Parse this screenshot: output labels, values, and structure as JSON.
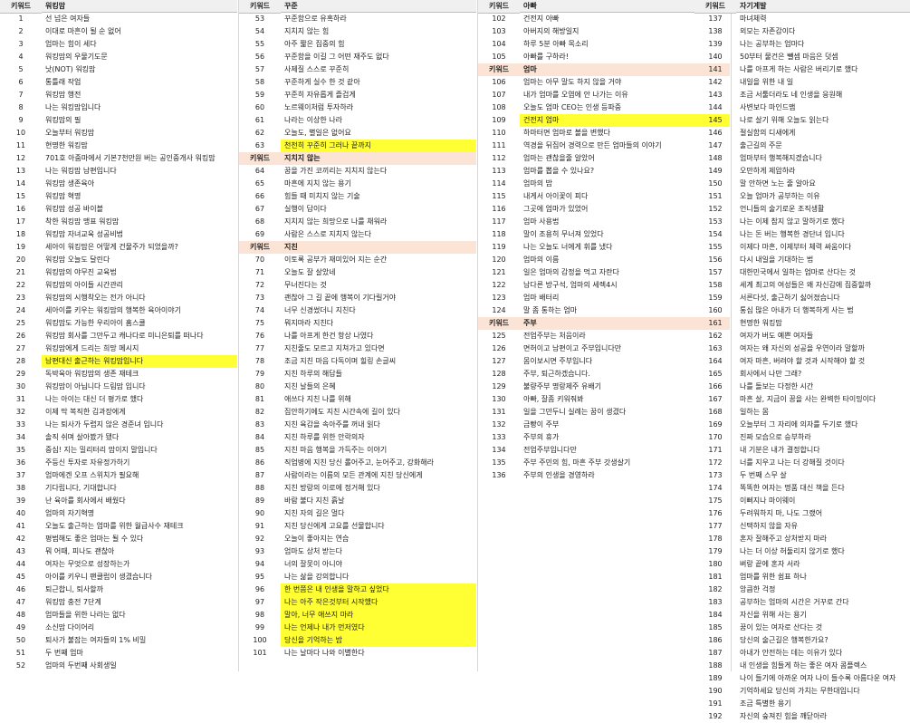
{
  "columns": [
    {
      "header": {
        "key": "키워드",
        "title": "워킹맘"
      },
      "rows": [
        {
          "n": "1",
          "t": "선 넘은 여자들"
        },
        {
          "n": "2",
          "t": "이대로 마흔이 될 순 없어"
        },
        {
          "n": "3",
          "t": "엄마는 힘이 세다"
        },
        {
          "n": "4",
          "t": "워킹맘의 우물기도문"
        },
        {
          "n": "5",
          "t": "낫(NOT) 워킹맘"
        },
        {
          "n": "6",
          "t": "통틀래 작업"
        },
        {
          "n": "7",
          "t": "워킹맘 행전"
        },
        {
          "n": "8",
          "t": "나는 워킹맘입니다"
        },
        {
          "n": "9",
          "t": "워킹맘의 필"
        },
        {
          "n": "10",
          "t": "오늘부터 워킹맘"
        },
        {
          "n": "11",
          "t": "현명한 워킹맘"
        },
        {
          "n": "12",
          "t": "701호 아줌마에서 기본7천만원 버는 공인중개사 워킹맘"
        },
        {
          "n": "13",
          "t": "나는 워킹맘 남편입니다"
        },
        {
          "n": "14",
          "t": "워킹맘 생존육아"
        },
        {
          "n": "15",
          "t": "워킹맘 혁명"
        },
        {
          "n": "16",
          "t": "워킹맘 성공 바이블"
        },
        {
          "n": "17",
          "t": "착한 워킹맘 맹표 워킹맘"
        },
        {
          "n": "18",
          "t": "워킹맘 자녀교육 성공비법"
        },
        {
          "n": "19",
          "t": "세아이 워킹맘은 어떻게 건물주가 되었을까?"
        },
        {
          "n": "20",
          "t": "워킹맘 오늘도 달린다"
        },
        {
          "n": "21",
          "t": "워킹맘의 야무진 교육법"
        },
        {
          "n": "22",
          "t": "워킹맘의 아이들 시간관리"
        },
        {
          "n": "23",
          "t": "워킹맘의 시행착오는 전가 아니다"
        },
        {
          "n": "24",
          "t": "세아이를 키우는 워킹맘의 행복한 육아이야기"
        },
        {
          "n": "25",
          "t": "워킹맘도 가능한 우리아이 홈스쿨"
        },
        {
          "n": "26",
          "t": "워킹맘 회사를 그만두고 캐나다로 미니은퇴를 떠나다"
        },
        {
          "n": "27",
          "t": "워킹맘에게 드리는 희망 메시지"
        },
        {
          "n": "28",
          "t": "남편대신 출근하는 워킹맘입니다",
          "hl": true
        },
        {
          "n": "29",
          "t": "독박육아 워킹맘의 생존 재테크"
        },
        {
          "n": "30",
          "t": "워킹맘이 아닙니다 드림맘 입니다"
        },
        {
          "n": "31",
          "t": "나는 아이는 대신 더 평가로 했다"
        },
        {
          "n": "32",
          "t": "이제 막 복직한 김과장에게"
        },
        {
          "n": "33",
          "t": "나는 퇴사가 두렵지 않은 경준녀 입니다"
        },
        {
          "n": "34",
          "t": "솔직 쉬며 살아봤가 됐다"
        },
        {
          "n": "35",
          "t": "중심! 지는 밀리터리 맘이지 말입니다"
        },
        {
          "n": "36",
          "t": "주등신 투자로 자유정가하기"
        },
        {
          "n": "37",
          "t": "엄마에겐 오프 스위치가 필요해"
        },
        {
          "n": "38",
          "t": "기다립니다, 기대합니다"
        },
        {
          "n": "39",
          "t": "난 육아를 회사에서 배웠다"
        },
        {
          "n": "40",
          "t": "엄마의 자기혁명"
        },
        {
          "n": "41",
          "t": "오늘도 출근하는 엄마를 위한 월급사수 재테크"
        },
        {
          "n": "42",
          "t": "평범해도 좋은 엄마는 될 수 있다"
        },
        {
          "n": "43",
          "t": "뭐 어때, 피나도 괜찮아"
        },
        {
          "n": "44",
          "t": "여자는 무엇으로 성장하는가"
        },
        {
          "n": "45",
          "t": "아이를 키우니 팬클럽이 생겼습니다"
        },
        {
          "n": "46",
          "t": "퇴근합니, 퇴사할까"
        },
        {
          "n": "47",
          "t": "워킹맘 충전 7단계"
        },
        {
          "n": "48",
          "t": "엄마들을 위한 나라는 없다"
        },
        {
          "n": "49",
          "t": "소신맘 다이어리"
        },
        {
          "n": "50",
          "t": "퇴사가 불잡는 여자들의 1% 비밀"
        },
        {
          "n": "51",
          "t": "두 번째 엄마"
        },
        {
          "n": "52",
          "t": "엄마의 두번째 사회생일"
        }
      ]
    },
    {
      "header": {
        "key": "키워드",
        "title": "꾸준"
      },
      "rows": [
        {
          "n": "53",
          "t": "꾸준함으로 유혹하라"
        },
        {
          "n": "54",
          "t": "지치지 않는 힘"
        },
        {
          "n": "55",
          "t": "아주 짧은 집중의 힘"
        },
        {
          "n": "56",
          "t": "꾸준함을 이길 그 어떤 재주도 없다"
        },
        {
          "n": "57",
          "t": "사제질 스스로 꾸준히"
        },
        {
          "n": "58",
          "t": "꾸준하게 실수 한 것 같아"
        },
        {
          "n": "59",
          "t": "꾸준히 자유롭게 즐겁게"
        },
        {
          "n": "60",
          "t": "노르웨이처럼 투자하라"
        },
        {
          "n": "61",
          "t": "나라는 이상한 나라"
        },
        {
          "n": "62",
          "t": "오늘도, 별일은 없어요"
        },
        {
          "n": "63",
          "t": "천천히 꾸준히 그러나 끝까지",
          "hl": true
        },
        {
          "sect": true,
          "key": "키워드",
          "title": "지치지 않는"
        },
        {
          "n": "64",
          "t": "꿈을 가진 코끼리는 지치지 않는다"
        },
        {
          "n": "65",
          "t": "마흔에 지치 않는 용기"
        },
        {
          "n": "66",
          "t": "힘들 때 미치지 않는 기술"
        },
        {
          "n": "67",
          "t": "실행이 답이다"
        },
        {
          "n": "68",
          "t": "지치지 않는 희망으로 나를 채워라"
        },
        {
          "n": "69",
          "t": "사람은 스스로 지치지 않는다"
        },
        {
          "sect": true,
          "key": "키워드",
          "title": "지친"
        },
        {
          "n": "70",
          "t": "이토록 공부가 재미있어 지는 순간"
        },
        {
          "n": "71",
          "t": "오늘도 잘 살았네"
        },
        {
          "n": "72",
          "t": "무너진다는 것"
        },
        {
          "n": "73",
          "t": "괜찮아 그 길 끝에 행복이 기다릴거야"
        },
        {
          "n": "74",
          "t": "너무 신경썼더니 지친다"
        },
        {
          "n": "75",
          "t": "뭐지마라 지친다"
        },
        {
          "n": "76",
          "t": "나를 아프게 한건 항상 나였다"
        },
        {
          "n": "77",
          "t": "지친줄도 모르고 지쳐가고 있다면"
        },
        {
          "n": "78",
          "t": "조금 지친 마음 다독이며 힐링 손글씨"
        },
        {
          "n": "79",
          "t": "지친 하루의 해답들"
        },
        {
          "n": "80",
          "t": "지친 날들의 은혜"
        },
        {
          "n": "81",
          "t": "애쓰다 지친 나를 위해"
        },
        {
          "n": "82",
          "t": "집안하기에도 지친 시간속에 길이 있다"
        },
        {
          "n": "83",
          "t": "지친 육감을 속아주를 꺼내 읽다"
        },
        {
          "n": "84",
          "t": "지친 하루를 위한 안락의자"
        },
        {
          "n": "85",
          "t": "지친 마음 행복을 가득주는 이야기"
        },
        {
          "n": "86",
          "t": "직업병에 지친 당신 롤어주고, 눈어주고, 강화해라"
        },
        {
          "n": "87",
          "t": "사람이라는 이름의 모든 관계에 지친 당신에게"
        },
        {
          "n": "88",
          "t": "지친 방랑의 이로에 정거해 있다"
        },
        {
          "n": "89",
          "t": "바람 불다 지친 흙날"
        },
        {
          "n": "90",
          "t": "지친 자의 길은 멀다"
        },
        {
          "n": "91",
          "t": "지친 당신에게 고요를 선물합니다"
        },
        {
          "n": "92",
          "t": "오늘이 좋아지는 연습"
        },
        {
          "n": "93",
          "t": "엄마도 상처 받는다"
        },
        {
          "n": "94",
          "t": "너의 잘못이 아니야"
        },
        {
          "n": "95",
          "t": "나는 삶을 강의합니다"
        },
        {
          "n": "96",
          "t": "한 번쯤은 내 인생을 말하고 싶었다",
          "hl": true
        },
        {
          "n": "97",
          "t": "나는 아주 작은것부터 시작했다",
          "hl": true
        },
        {
          "n": "98",
          "t": "말아, 너무 애쓰지 마라",
          "hl": true
        },
        {
          "n": "99",
          "t": "나는 언제나 내가 먼저였다",
          "hl": true
        },
        {
          "n": "100",
          "t": "당신을 기억하는 밤",
          "hl": true
        },
        {
          "n": "101",
          "t": "나는 날마다 나와 이별한다"
        }
      ]
    },
    {
      "header": {
        "key": "키워드",
        "title": "아빠"
      },
      "rows": [
        {
          "n": "102",
          "t": "건전지 아빠"
        },
        {
          "n": "103",
          "t": "아버지의 해방일지"
        },
        {
          "n": "104",
          "t": "하루 5분 아빠 목소리"
        },
        {
          "n": "105",
          "t": "아빠를 구하라!"
        },
        {
          "sect": true,
          "key": "키워드",
          "title": "엄마"
        },
        {
          "n": "106",
          "t": "엄마는 아무 말도 하지 않을 거야"
        },
        {
          "n": "107",
          "t": "내가 엄마를 오염에 안 나가는 이유"
        },
        {
          "n": "108",
          "t": "오늘도 엄마 CEO는 인생 등파중"
        },
        {
          "n": "109",
          "t": "건전지 엄마",
          "hl": true
        },
        {
          "n": "110",
          "t": "하마터면 엄마로 볼을 변했다"
        },
        {
          "n": "111",
          "t": "역경을 뒤집어 경력으로 만든 엄마들의 이야기"
        },
        {
          "n": "112",
          "t": "엄마는 괜찮을줄 알았어"
        },
        {
          "n": "113",
          "t": "엄마를 뽑을 수 있나요?"
        },
        {
          "n": "114",
          "t": "엄마의 밥"
        },
        {
          "n": "115",
          "t": "내게서 아이꽃이 피다"
        },
        {
          "n": "116",
          "t": "그곳에 엄마가 있었어"
        },
        {
          "n": "117",
          "t": "엄마 사용법"
        },
        {
          "n": "118",
          "t": "말이 조용히 무너져 있었다"
        },
        {
          "n": "119",
          "t": "나는 오늘도 너에게 휘를 냈다"
        },
        {
          "n": "120",
          "t": "엄마의 이름"
        },
        {
          "n": "121",
          "t": "일은 엄마의 감정을 먹고 자란다"
        },
        {
          "n": "122",
          "t": "남다른 방구석, 엄마의 세렉4시"
        },
        {
          "n": "123",
          "t": "엄마 배터리"
        },
        {
          "n": "124",
          "t": "말 좀 통하는 엄마"
        },
        {
          "sect": true,
          "key": "키워드",
          "title": "주부"
        },
        {
          "n": "125",
          "t": "전업주부는 처음이라"
        },
        {
          "n": "126",
          "t": "면허이고 남편이고 주부입니다만"
        },
        {
          "n": "127",
          "t": "몸이보시면 주부입니다"
        },
        {
          "n": "128",
          "t": "주부, 퇴근하겠습니다."
        },
        {
          "n": "129",
          "t": "불량주부 명랑제주 유배기"
        },
        {
          "n": "130",
          "t": "아빠, 잘좀 키워줘봐"
        },
        {
          "n": "131",
          "t": "일을 그만두니 실례는 꿈이 생겼다"
        },
        {
          "n": "132",
          "t": "금빵이 주부"
        },
        {
          "n": "133",
          "t": "주부의 휴가"
        },
        {
          "n": "134",
          "t": "전업주부입니다만"
        },
        {
          "n": "135",
          "t": "주부 주민의 힘, 마흔 주부 갓생살기"
        },
        {
          "n": "136",
          "t": "주부의 인생을 경영하라"
        }
      ]
    },
    {
      "header": {
        "key": "키워드",
        "title": "자기계발"
      },
      "rows": [
        {
          "n": "137",
          "t": "마녀체력"
        },
        {
          "n": "138",
          "t": "외모는 자존감이다"
        },
        {
          "n": "139",
          "t": "나는 공부하는 엄마다"
        },
        {
          "n": "140",
          "t": "50부터 물건은 뺄셈 마음은 덧셈"
        },
        {
          "n": "141",
          "t": "나를 아프게 하는 사람은 버리기로 했다"
        },
        {
          "n": "142",
          "t": "내일을 위한 내 일"
        },
        {
          "n": "143",
          "t": "조금 서툴더라도 네 인생을 응원해"
        },
        {
          "n": "144",
          "t": "사변보다 마인드맵"
        },
        {
          "n": "145",
          "t": "나로 살기 위해 오늘도 읽는다"
        },
        {
          "n": "146",
          "t": "절실함의 디새에게"
        },
        {
          "n": "147",
          "t": "출근길의 주문"
        },
        {
          "n": "148",
          "t": "엄마부터 행복해지겠습니다"
        },
        {
          "n": "149",
          "t": "오만하게 제압하라"
        },
        {
          "n": "150",
          "t": "말 안하면 노는 줄 알아요"
        },
        {
          "n": "151",
          "t": "오늘 엄마가 공부하는 이유"
        },
        {
          "n": "152",
          "t": "언니들의 술기로운 조직생활"
        },
        {
          "n": "153",
          "t": "나는 이제 참지 않고 말하기로 했다"
        },
        {
          "n": "154",
          "t": "나는 돈 버는 행복한 경단녀 입니다"
        },
        {
          "n": "155",
          "t": "이제다 마흔, 이제부터 체력 싸움이다"
        },
        {
          "n": "156",
          "t": "다시 내일을 기대하는 법"
        },
        {
          "n": "157",
          "t": "대한민국에서 일하는 엄마로 산다는 것"
        },
        {
          "n": "158",
          "t": "세계 최고의 여성들은 왜 자신감에 집중할까"
        },
        {
          "n": "159",
          "t": "서른다섯, 출근하기 싫어졌습니다"
        },
        {
          "n": "160",
          "t": "통심 많은 아내가 더 행복하게 사는 법"
        },
        {
          "n": "161",
          "t": "현명한 워킹맘"
        },
        {
          "n": "162",
          "t": "여자가 버도 예쁜 여자들"
        },
        {
          "n": "163",
          "t": "여자는 왜 자신의 성공을 우연이라 말할까"
        },
        {
          "n": "164",
          "t": "여자 마흔, 버려야 할 것과 시작해야 할 것"
        },
        {
          "n": "165",
          "t": "회사에서 나만 그래?"
        },
        {
          "n": "166",
          "t": "나를 돌보는 다정한 시간"
        },
        {
          "n": "167",
          "t": "마흔 살, 지금이 꿈을 사는 완벽한 타이밍이다"
        },
        {
          "n": "168",
          "t": "일하는 몸"
        },
        {
          "n": "169",
          "t": "오늘부터 그 자리에 의자를 두기로 했다"
        },
        {
          "n": "170",
          "t": "진짜 모습으로 승부하라"
        },
        {
          "n": "171",
          "t": "내 기분은 내가 결정합니다"
        },
        {
          "n": "172",
          "t": "너를 지우고 나는 더 강해질 것이다"
        },
        {
          "n": "173",
          "t": "두 번째 스무 살"
        },
        {
          "n": "174",
          "t": "똑똑한 여자는 명품 대신 책을 든다"
        },
        {
          "n": "175",
          "t": "이뻐지나 마이웨이"
        },
        {
          "n": "176",
          "t": "두려워하지 마, 나도 그랬어"
        },
        {
          "n": "177",
          "t": "신택하지 않을 자유"
        },
        {
          "n": "178",
          "t": "혼자 잘해주고 상처받지 마라"
        },
        {
          "n": "179",
          "t": "나는 더 이상 허둘리지 않기로 했다"
        },
        {
          "n": "180",
          "t": "벼랑 끝에 혼자 서라"
        },
        {
          "n": "181",
          "t": "엄마를 위한 쉼표 하나"
        },
        {
          "n": "182",
          "t": "앙큼한 걱정"
        },
        {
          "n": "183",
          "t": "공부하는 엄마의 시간은 거꾸로 간다"
        },
        {
          "n": "184",
          "t": "자신을 위해 사는 용기"
        },
        {
          "n": "185",
          "t": "꿈이 있는 여자로 산다는 것"
        },
        {
          "n": "186",
          "t": "당신의 술근길은 행복한가요?"
        },
        {
          "n": "187",
          "t": "아내가 안전하는 데는 이유가 있다"
        },
        {
          "n": "188",
          "t": "내 인생을 힘들게 하는 좋은 여자 콤플렉스"
        },
        {
          "n": "189",
          "t": "나이 들기에 아까운 여자 나이 들수록 아름다운 여자"
        },
        {
          "n": "190",
          "t": "기억하세요 당신의 가치는 무한대입니다"
        },
        {
          "n": "191",
          "t": "조금 특별한 용기"
        },
        {
          "n": "192",
          "t": "자신의 숲져진 힘을 깨닫아라"
        }
      ]
    }
  ],
  "colors": {
    "highlight": "#ffff33",
    "section": "#fbe4d5",
    "header": "#f0f0f0"
  }
}
